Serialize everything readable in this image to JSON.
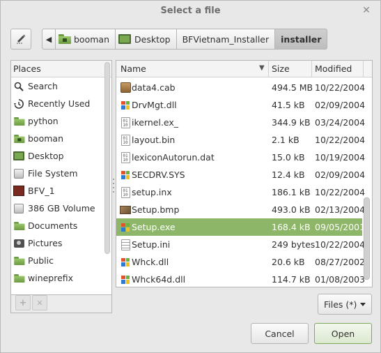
{
  "window": {
    "title": "Select a file",
    "close_glyph": "✕"
  },
  "toolbar": {
    "edit_icon": "pencil-icon",
    "back_glyph": "◀"
  },
  "breadcrumbs": [
    {
      "label": "booman",
      "icon": "home-folder-icon"
    },
    {
      "label": "Desktop",
      "icon": "desktop-icon"
    },
    {
      "label": "BFVietnam_Installer",
      "icon": ""
    },
    {
      "label": "installer",
      "icon": "",
      "active": true
    }
  ],
  "places": {
    "header": "Places",
    "items": [
      {
        "label": "Search",
        "icon": "search-icon"
      },
      {
        "label": "Recently Used",
        "icon": "clock-icon"
      },
      {
        "label": "python",
        "icon": "folder-icon"
      },
      {
        "label": "booman",
        "icon": "home-folder-icon"
      },
      {
        "label": "Desktop",
        "icon": "desktop-icon"
      },
      {
        "label": "File System",
        "icon": "drive-icon"
      },
      {
        "label": "BFV_1",
        "icon": "bfv-disc-icon"
      },
      {
        "label": "386 GB Volume",
        "icon": "drive-icon"
      },
      {
        "label": "Documents",
        "icon": "folder-icon"
      },
      {
        "label": "Pictures",
        "icon": "camera-icon"
      },
      {
        "label": "Public",
        "icon": "folder-icon"
      },
      {
        "label": "wineprefix",
        "icon": "folder-icon"
      }
    ],
    "add_glyph": "+",
    "remove_glyph": "✕"
  },
  "files": {
    "columns": {
      "name": "Name",
      "size": "Size",
      "modified": "Modified",
      "sort_glyph": "▼"
    },
    "rows": [
      {
        "name": "data4.cab",
        "size": "494.5 MB",
        "modified": "10/22/2004",
        "icon": "cab-icon"
      },
      {
        "name": "DrvMgt.dll",
        "size": "41.5 kB",
        "modified": "02/09/2004",
        "icon": "windows-icon"
      },
      {
        "name": "ikernel.ex_",
        "size": "344.9 kB",
        "modified": "03/24/2004",
        "icon": "binary-icon"
      },
      {
        "name": "layout.bin",
        "size": "2.1 kB",
        "modified": "10/22/2004",
        "icon": "binary-icon"
      },
      {
        "name": "lexiconAutorun.dat",
        "size": "15.0 kB",
        "modified": "10/19/2004",
        "icon": "binary-icon"
      },
      {
        "name": "SECDRV.SYS",
        "size": "12.4 kB",
        "modified": "02/09/2004",
        "icon": "windows-icon"
      },
      {
        "name": "setup.inx",
        "size": "186.1 kB",
        "modified": "10/22/2004",
        "icon": "binary-icon"
      },
      {
        "name": "Setup.bmp",
        "size": "493.0 kB",
        "modified": "02/13/2004",
        "icon": "image-icon"
      },
      {
        "name": "Setup.exe",
        "size": "168.4 kB",
        "modified": "09/05/2001",
        "icon": "windows-icon",
        "selected": true
      },
      {
        "name": "Setup.ini",
        "size": "249 bytes",
        "modified": "10/22/2004",
        "icon": "text-icon"
      },
      {
        "name": "Whck.dll",
        "size": "20.6 kB",
        "modified": "08/27/2002",
        "icon": "windows-icon"
      },
      {
        "name": "Whck64d.dll",
        "size": "114.7 kB",
        "modified": "01/08/2003",
        "icon": "windows-icon"
      }
    ]
  },
  "filter": {
    "label": "Files (*)"
  },
  "actions": {
    "cancel": "Cancel",
    "open": "Open"
  },
  "colors": {
    "selection": "#8eb669",
    "folder": "#7aa851",
    "accent": "#7fa85a"
  }
}
